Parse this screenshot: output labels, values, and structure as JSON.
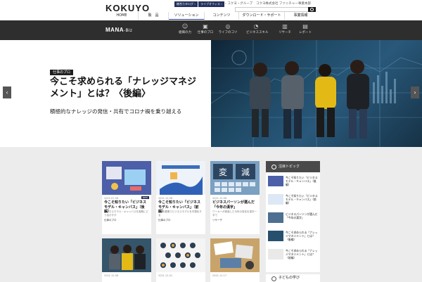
{
  "header": {
    "logo": "KOKUYO",
    "pill_catalog": "総合カタログ ›",
    "pill_live": "ライブオフィス ›",
    "link_group": "› コクヨ・グループ",
    "link_company": "コクヨ株式会社 ファニチャー事業本部",
    "nav": [
      {
        "label": "HOME"
      },
      {
        "label": "製　品"
      },
      {
        "label": "ソリューション"
      },
      {
        "label": "コンテンツ"
      },
      {
        "label": "ダウンロード・サポート"
      },
      {
        "label": "事業情報"
      }
    ]
  },
  "subnav": {
    "brand": "MANA",
    "brand_suffix": "-Biz",
    "items": [
      {
        "label": "組織の力",
        "icon": "people-icon"
      },
      {
        "label": "仕事のプロ",
        "icon": "briefcase-icon"
      },
      {
        "label": "ライフのコツ",
        "icon": "lifebuoy-icon"
      },
      {
        "label": "ビジネススキル",
        "icon": "chart-icon"
      },
      {
        "label": "リサーチ",
        "icon": "bars-icon"
      },
      {
        "label": "レポート",
        "icon": "report-icon"
      }
    ]
  },
  "hero": {
    "badge": "仕事のプロ",
    "title": "今こそ求められる「ナレッジマネジメント」とは？〈後編〉",
    "subtitle": "積極的なナレッジの発信・共有でコロナ禍を乗り越える",
    "prev": "‹",
    "next": "›"
  },
  "cards": [
    {
      "date": "2021.07.08",
      "new": "NEW",
      "title": "今こそ知りたい「ビジネスモデル・キャンバス」（後編）",
      "desc": "ビジネスモデル・キャンバスを実務にどう活かすか",
      "tag": "仕事のプロ"
    },
    {
      "date": "2021.12.08",
      "new": "",
      "title": "今こそ知りたい「ビジネスモデル・キャンバス」（前編）",
      "desc": "9つの要素でビジネスモデルを可視化する",
      "tag": "仕事のプロ"
    },
    {
      "date": "2021.12.08",
      "new": "",
      "title": "ビジネスパーソンが選んだ「今年の漢字」",
      "desc": "ワーカーが実感した今年の変化を漢字一字で",
      "tag": "リサーチ"
    },
    {
      "date": "2021.12.08",
      "new": "",
      "title": "",
      "desc": "",
      "tag": ""
    },
    {
      "date": "2021.12.01",
      "new": "",
      "title": "",
      "desc": "",
      "tag": ""
    },
    {
      "date": "2021.11.17",
      "new": "",
      "title": "",
      "desc": "",
      "tag": ""
    }
  ],
  "sidebar": {
    "heading": "注目トピック",
    "items": [
      {
        "text": "今こそ知りたい「ビジネスモデル・キャンバス」（後編）"
      },
      {
        "text": "今こそ知りたい「ビジネスモデル・キャンバス」（前編）"
      },
      {
        "text": "ビジネスパーソンが選んだ「今年の漢字」"
      },
      {
        "text": "今こそ求められる「ナレッジマネジメント」とは？〈後編〉"
      },
      {
        "text": "今こそ求められる「ナレッジマネジメント」とは？〈前編〉"
      }
    ],
    "heading2": "子どもの学び"
  },
  "colors": {
    "navy": "#23315e",
    "dark": "#2e2e2e",
    "gray": "#ececec"
  }
}
